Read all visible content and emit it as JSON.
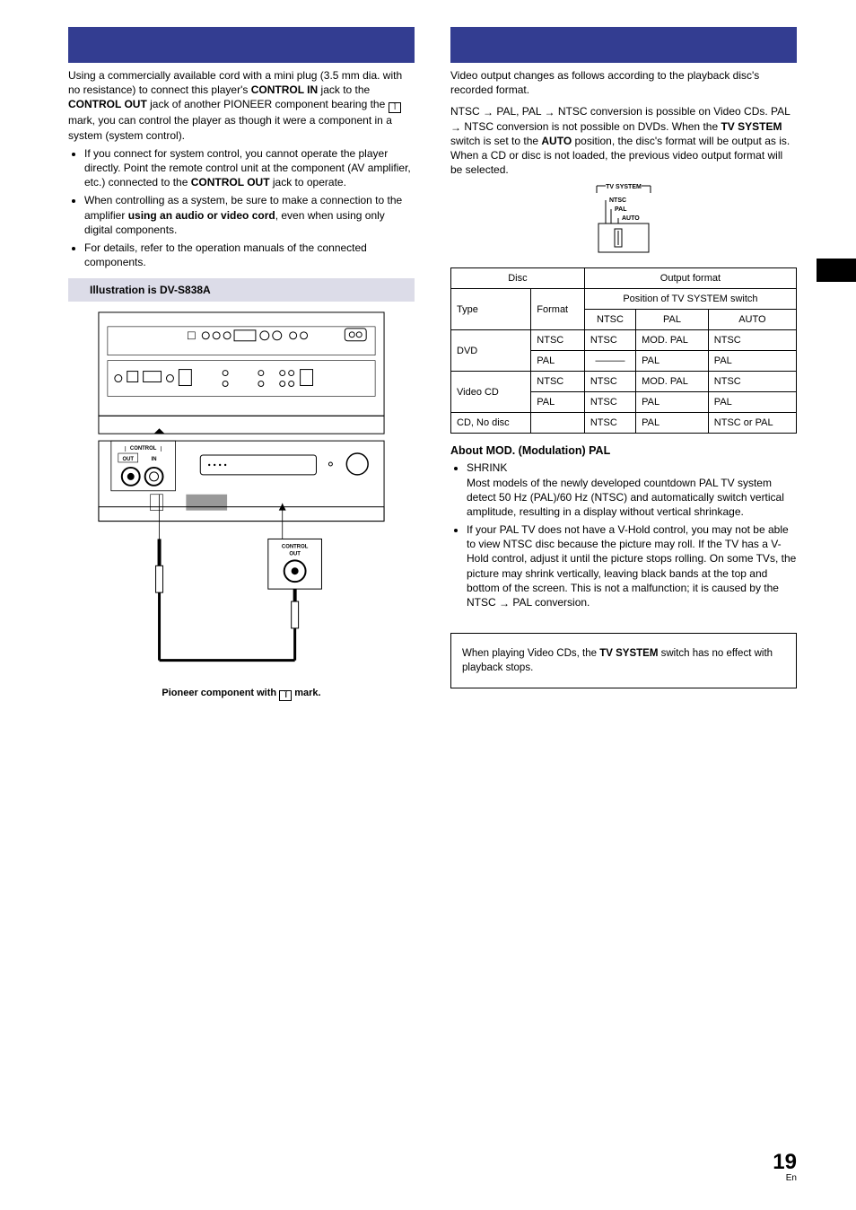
{
  "left": {
    "intro_1a": "Using a commercially available cord with a mini plug (3.5 mm dia. with no resistance) to connect this player's ",
    "bold_control_in": "CONTROL IN",
    "intro_1b": " jack to the ",
    "bold_control_out": "CONTROL OUT",
    "intro_1c": " jack of another PIONEER component bearing the ",
    "intro_1d": " mark, you can control the player as though it were a component in a system (system control).",
    "bullet1a": "If you connect for system control, you cannot operate the player directly. Point the remote control unit at the component (AV amplifier, etc.) connected to the ",
    "bullet1b": " jack to operate.",
    "bullet2a": "When controlling as a system, be sure to make a connection to the amplifier ",
    "bullet2_bold": "using an audio or video cord",
    "bullet2b": ", even when using only digital components.",
    "bullet3": "For details, refer to the operation manuals of the connected components.",
    "illus_title": "Illustration is DV-S838A",
    "diagram_control_label": "CONTROL",
    "diagram_out": "OUT",
    "diagram_in": "IN",
    "diagram_control_out_label": "CONTROL OUT",
    "pioneer_caption_a": "Pioneer component with ",
    "pioneer_caption_b": " mark."
  },
  "right": {
    "intro": "Video output changes as follows according to the playback disc's recorded format.",
    "para2a": "NTSC ",
    "para2b": " PAL, PAL ",
    "para2c": " NTSC conversion is possible on Video CDs. PAL ",
    "para2d": " NTSC conversion is not possible on DVDs. When the ",
    "bold_tvsys": "TV SYSTEM",
    "para2e": " switch is set to the ",
    "bold_auto": "AUTO",
    "para2f": " position, the disc's format will be output as is. When a CD or disc is not loaded, the previous video output format will be selected.",
    "switch_labels": {
      "head": "TV SYSTEM",
      "a": "NTSC",
      "b": "PAL",
      "c": "AUTO"
    },
    "table": {
      "h_disc": "Disc",
      "h_output": "Output format",
      "h_type": "Type",
      "h_format": "Format",
      "h_position": "Position of TV SYSTEM switch",
      "h_ntsc": "NTSC",
      "h_pal": "PAL",
      "h_auto": "AUTO",
      "rows": [
        {
          "type": "DVD",
          "format": "NTSC",
          "ntsc": "NTSC",
          "pal": "MOD. PAL",
          "auto": "NTSC"
        },
        {
          "type": "",
          "format": "PAL",
          "ntsc": "———",
          "pal": "PAL",
          "auto": "PAL"
        },
        {
          "type": "Video CD",
          "format": "NTSC",
          "ntsc": "NTSC",
          "pal": "MOD. PAL",
          "auto": "NTSC"
        },
        {
          "type": "",
          "format": "PAL",
          "ntsc": "NTSC",
          "pal": "PAL",
          "auto": "PAL"
        },
        {
          "type": "CD, No disc",
          "format": "",
          "ntsc": "NTSC",
          "pal": "PAL",
          "auto": "NTSC or PAL"
        }
      ]
    },
    "mod_title": "About MOD. (Modulation) PAL",
    "mod_b1_head": "SHRINK",
    "mod_b1_body": "Most models of the newly developed countdown PAL TV system detect 50 Hz (PAL)/60 Hz (NTSC) and automatically switch vertical amplitude, resulting in a display without vertical shrinkage.",
    "mod_b2a": "If your PAL TV does not have a V-Hold control, you may not be able to view NTSC disc because the picture may roll. If the TV has a V-Hold control, adjust it until the picture stops rolling. On some TVs, the picture may shrink vertically, leaving black bands at the top and bottom of the screen. This is not a malfunction; it is caused by the NTSC ",
    "mod_b2b": " PAL conversion.",
    "note_a": "When playing Video CDs, the ",
    "note_bold": "TV SYSTEM",
    "note_b": " switch has no effect with playback stops."
  },
  "page": {
    "num": "19",
    "lang": "En"
  }
}
